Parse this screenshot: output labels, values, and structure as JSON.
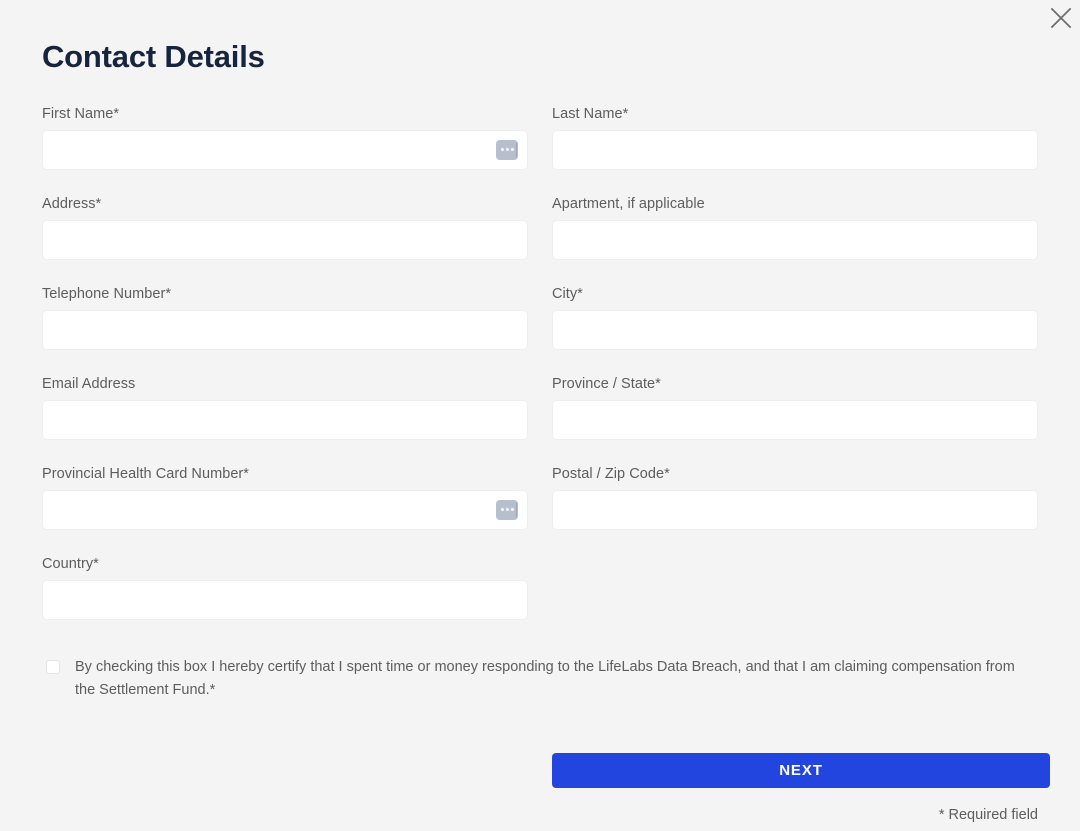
{
  "window": {
    "background_color": "#f4f4f4"
  },
  "close": {
    "icon": "close-icon",
    "label": "Close"
  },
  "header": {
    "title": "Contact Details",
    "title_color": "#16243d"
  },
  "form": {
    "fields": [
      {
        "id": "first-name",
        "label": "First Name*",
        "value": "",
        "placeholder": "",
        "column": "left",
        "has_autofill_badge": true
      },
      {
        "id": "last-name",
        "label": "Last Name*",
        "value": "",
        "placeholder": "",
        "column": "right",
        "has_autofill_badge": false
      },
      {
        "id": "address",
        "label": "Address*",
        "value": "",
        "placeholder": "",
        "column": "left",
        "has_autofill_badge": false
      },
      {
        "id": "apartment",
        "label": "Apartment, if applicable",
        "value": "",
        "placeholder": "",
        "column": "right",
        "has_autofill_badge": false
      },
      {
        "id": "telephone-number",
        "label": "Telephone Number*",
        "value": "",
        "placeholder": "",
        "column": "left",
        "has_autofill_badge": false
      },
      {
        "id": "city",
        "label": "City*",
        "value": "",
        "placeholder": "",
        "column": "right",
        "has_autofill_badge": false
      },
      {
        "id": "email-address",
        "label": "Email Address",
        "value": "",
        "placeholder": "",
        "column": "left",
        "has_autofill_badge": false
      },
      {
        "id": "province-state",
        "label": "Province / State*",
        "value": "",
        "placeholder": "",
        "column": "right",
        "has_autofill_badge": false
      },
      {
        "id": "provincial-health-card-number",
        "label": "Provincial Health Card Number*",
        "value": "",
        "placeholder": "",
        "column": "left",
        "has_autofill_badge": true
      },
      {
        "id": "postal-zip-code",
        "label": "Postal / Zip Code*",
        "value": "",
        "placeholder": "",
        "column": "right",
        "has_autofill_badge": false
      },
      {
        "id": "country",
        "label": "Country*",
        "value": "",
        "placeholder": "",
        "column": "left",
        "has_autofill_badge": false
      }
    ]
  },
  "consent": {
    "checked": false,
    "text": "By checking this box I hereby certify that I spent time or money responding to the LifeLabs Data Breach, and that I am claiming compensation from the Settlement Fund.*"
  },
  "footer": {
    "next_label": "NEXT",
    "next_color": "#2345df",
    "required_note": "* Required field"
  }
}
